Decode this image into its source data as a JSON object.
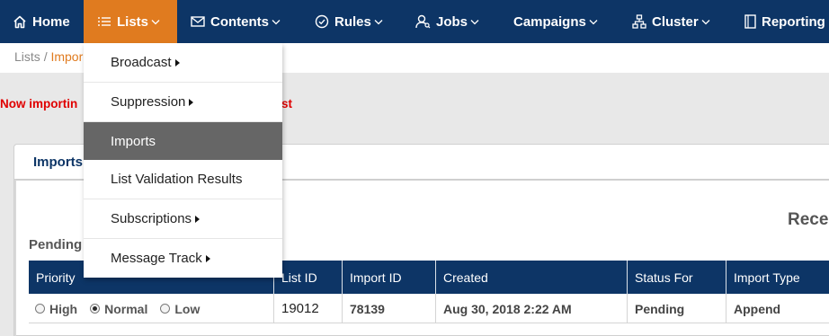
{
  "nav": {
    "items": [
      {
        "label": "Home",
        "icon": "home-icon"
      },
      {
        "label": "Lists",
        "icon": "list-icon"
      },
      {
        "label": "Contents",
        "icon": "envelope-icon"
      },
      {
        "label": "Rules",
        "icon": "check-circle-icon"
      },
      {
        "label": "Jobs",
        "icon": "user-search-icon"
      },
      {
        "label": "Campaigns"
      },
      {
        "label": "Cluster",
        "icon": "sitemap-icon"
      },
      {
        "label": "Reporting",
        "icon": "report-icon"
      }
    ]
  },
  "breadcrumb": {
    "root": "Lists",
    "separator": "/",
    "current": "Impor"
  },
  "notice": {
    "lead": "Now importin",
    "tail": "st"
  },
  "panel": {
    "tab_label": "Imports",
    "recent_heading": "Rece",
    "pending_heading": "Pending"
  },
  "table": {
    "columns": [
      "Priority",
      "List ID",
      "Import ID",
      "Created",
      "Status For",
      "Import Type"
    ],
    "row": {
      "priority_options": [
        "High",
        "Normal",
        "Low"
      ],
      "priority_selected": "Normal",
      "list_id": "19012",
      "import_id": "78139",
      "created": "Aug 30, 2018 2:22 AM",
      "status": "Pending",
      "import_type": "Append"
    }
  },
  "dropdown": {
    "items": [
      {
        "label": "Broadcast",
        "submenu": true
      },
      {
        "label": "Suppression",
        "submenu": true
      },
      {
        "label": "Imports",
        "submenu": false,
        "highlighted": true
      },
      {
        "label": "List Validation Results",
        "submenu": false
      },
      {
        "label": "Subscriptions",
        "submenu": true
      },
      {
        "label": "Message Track",
        "submenu": true
      }
    ]
  },
  "colors": {
    "nav_bg": "#0d3566",
    "accent": "#e07b1f",
    "notice": "#e00000",
    "menu_highlight": "#666666"
  }
}
